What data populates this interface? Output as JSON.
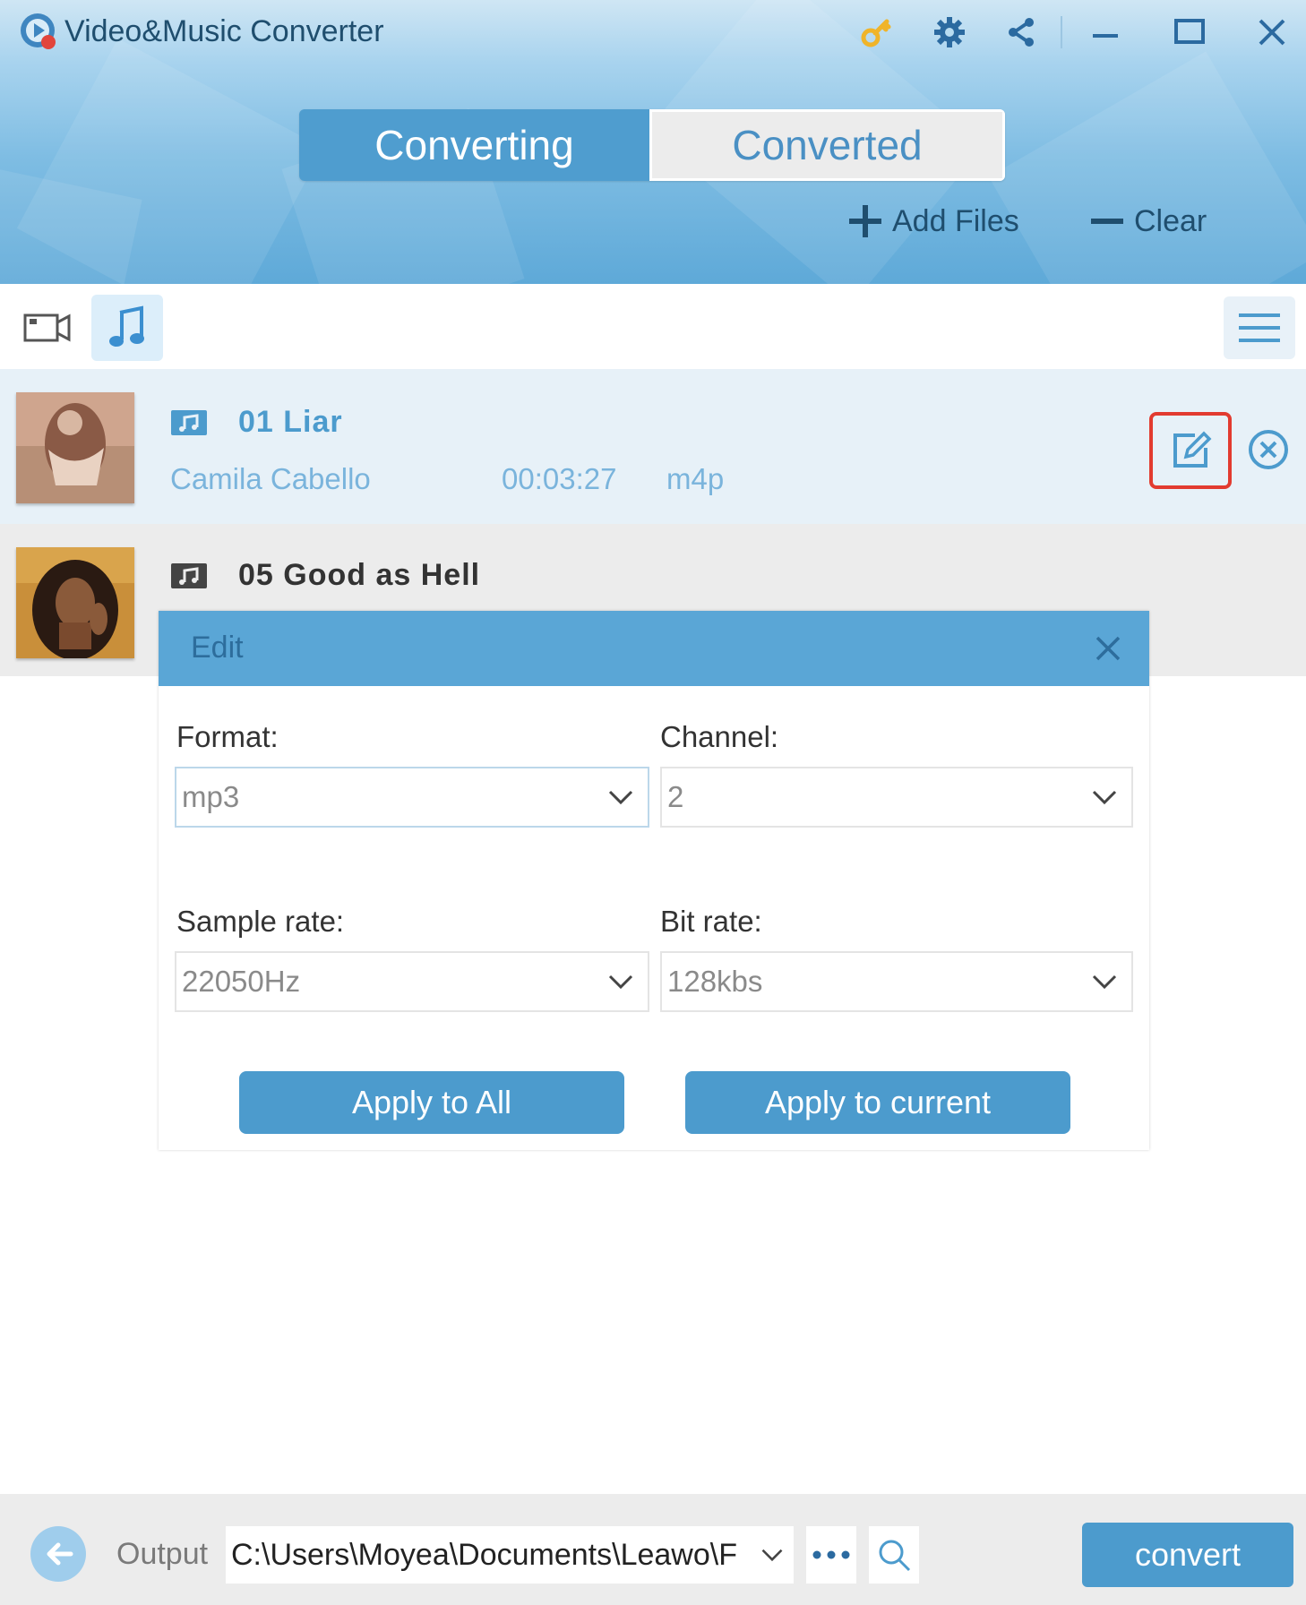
{
  "window": {
    "title": "Video&Music Converter"
  },
  "tabs": [
    {
      "label": "Converting",
      "active": true
    },
    {
      "label": "Converted",
      "active": false
    }
  ],
  "header_actions": {
    "add_files": "Add Files",
    "clear": "Clear"
  },
  "files": [
    {
      "title": "01 Liar",
      "artist": "Camila Cabello",
      "duration": "00:03:27",
      "format": "m4p",
      "selected": true
    },
    {
      "title": "05 Good as Hell"
    }
  ],
  "edit_dialog": {
    "title": "Edit",
    "format_label": "Format:",
    "format_value": "mp3",
    "channel_label": "Channel:",
    "channel_value": "2",
    "sample_rate_label": "Sample rate:",
    "sample_rate_value": "22050Hz",
    "bit_rate_label": "Bit rate:",
    "bit_rate_value": "128kbs",
    "apply_all": "Apply to All",
    "apply_current": "Apply to current"
  },
  "bottom": {
    "output_label": "Output",
    "output_path": "C:\\Users\\Moyea\\Documents\\Leawo\\F",
    "convert": "convert"
  },
  "colors": {
    "accent": "#4c9bcd",
    "highlight_border": "#e23b30",
    "key_icon": "#f0b429"
  },
  "icons": [
    "app-logo-icon",
    "key-icon",
    "gear-icon",
    "share-icon",
    "minimize-icon",
    "maximize-icon",
    "close-icon",
    "plus-icon",
    "minus-icon",
    "video-camera-icon",
    "music-note-icon",
    "hamburger-menu-icon",
    "audio-file-icon",
    "edit-icon",
    "remove-circle-icon",
    "chevron-down-icon",
    "back-arrow-icon",
    "ellipsis-icon",
    "search-icon"
  ]
}
